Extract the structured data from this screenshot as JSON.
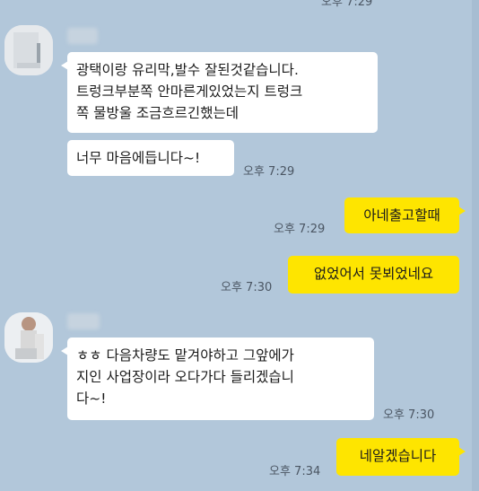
{
  "colors": {
    "background": "#b2c7da",
    "incoming_bubble": "#ffffff",
    "outgoing_bubble": "#fee500",
    "time_text": "#4b5663"
  },
  "top_time": "오후 7:29",
  "messages": [
    {
      "id": "m1",
      "direction": "incoming",
      "lines": [
        "광택이랑 유리막,발수 잘된것같습니다.",
        "트렁크부분쪽 안마른게있었는지 트렁크",
        "쪽 물방울 조금흐르긴했는데"
      ],
      "time": ""
    },
    {
      "id": "m2",
      "direction": "incoming",
      "lines": [
        "너무 마음에듭니다~!"
      ],
      "time": "오후 7:29"
    },
    {
      "id": "m3",
      "direction": "outgoing",
      "lines": [
        "아네출고할때"
      ],
      "time": "오후 7:29"
    },
    {
      "id": "m4",
      "direction": "outgoing",
      "lines": [
        "없었어서 못뵈었네요"
      ],
      "time": "오후 7:30"
    },
    {
      "id": "m5",
      "direction": "incoming",
      "lines": [
        "ㅎㅎ 다음차량도 맡겨야하고 그앞에가",
        "지인 사업장이라 오다가다 들리겠습니",
        "다~!"
      ],
      "time": "오후 7:30"
    },
    {
      "id": "m6",
      "direction": "outgoing",
      "lines": [
        "네알겠습니다"
      ],
      "time": "오후 7:34"
    }
  ]
}
